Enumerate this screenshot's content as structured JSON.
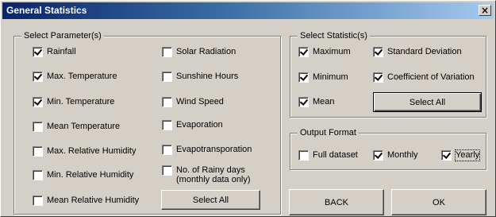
{
  "window": {
    "title": "General Statistics",
    "close_glyph": "×"
  },
  "parameters": {
    "legend": "Select Parameter(s)",
    "items": [
      {
        "label": "Rainfall",
        "checked": true
      },
      {
        "label": "Max. Temperature",
        "checked": true
      },
      {
        "label": "Min. Temperature",
        "checked": true
      },
      {
        "label": "Mean Temperature",
        "checked": false
      },
      {
        "label": "Max. Relative Humidity",
        "checked": false
      },
      {
        "label": "Min. Relative Humidity",
        "checked": false
      },
      {
        "label": "Mean Relative Humidity",
        "checked": false
      },
      {
        "label": "Solar Radiation",
        "checked": false
      },
      {
        "label": "Sunshine Hours",
        "checked": false
      },
      {
        "label": "Wind Speed",
        "checked": false
      },
      {
        "label": "Evaporation",
        "checked": false
      },
      {
        "label": "Evapotransporation",
        "checked": false
      },
      {
        "label": "No. of Rainy days (monthly data only)",
        "checked": false
      }
    ],
    "select_all_label": "Select All"
  },
  "statistics": {
    "legend": "Select Statistic(s)",
    "items": [
      {
        "label": "Maximum",
        "checked": true
      },
      {
        "label": "Minimum",
        "checked": true
      },
      {
        "label": "Mean",
        "checked": true
      },
      {
        "label": "Standard Deviation",
        "checked": true
      },
      {
        "label": "Coefficient of Variation",
        "checked": true
      }
    ],
    "select_all_label": "Select All"
  },
  "output": {
    "legend": "Output Format",
    "items": [
      {
        "label": "Full dataset",
        "checked": false
      },
      {
        "label": "Monthly",
        "checked": true
      },
      {
        "label": "Yearly",
        "checked": true
      }
    ]
  },
  "buttons": {
    "back_label": "BACK",
    "ok_label": "OK"
  }
}
